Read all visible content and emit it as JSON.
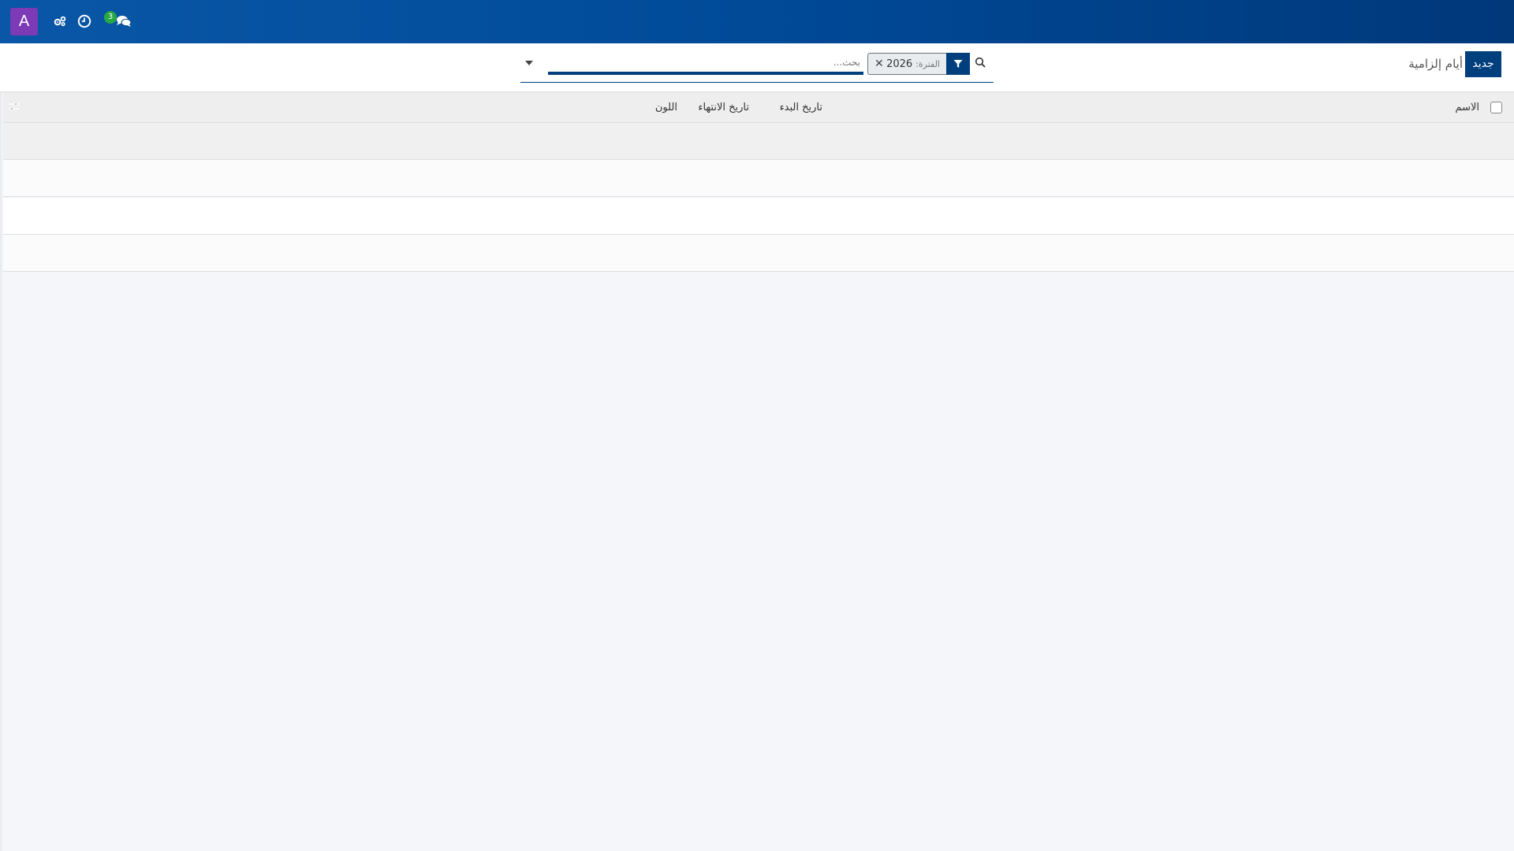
{
  "navbar": {
    "user_initial": "A",
    "chat_badge_count": "3",
    "icons": [
      "avatar",
      "settings-cogs-icon",
      "clock-icon",
      "chat-bubbles-icon"
    ]
  },
  "control_panel": {
    "new_button_label": "جديد",
    "page_title": "أيام إلزامية"
  },
  "search": {
    "placeholder": "بحث...",
    "facet_label": "الفترة:",
    "facet_value": "2026"
  },
  "table": {
    "columns": {
      "name": "الاسم",
      "start_date": "تاريخ البدء",
      "end_date": "تاريخ الانتهاء",
      "color": "اللون"
    },
    "rows": []
  },
  "colors": {
    "navbar_start": "#0a57a7",
    "navbar_end": "#00387a",
    "primary": "#003f7d",
    "avatar_bg": "#7c3ab6",
    "badge_bg": "#28a745"
  }
}
